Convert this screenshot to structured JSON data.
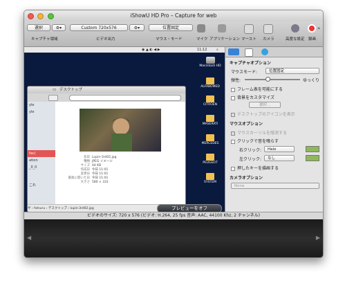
{
  "window": {
    "title": "iShowU HD Pro – Capture for web"
  },
  "toolbar": {
    "select_button": "選択",
    "capture_area_label": "キャプチャ領域",
    "preset_value": "Custom 720x576",
    "video_output_label": "ビデオ出力",
    "mouse_mode_value": "位置固定",
    "mouse_mode_label": "マウス・モード",
    "mic_label": "マイク",
    "app_label": "アプリケーション",
    "mouse_label": "マースト",
    "camera_label": "カメラ",
    "prefs_label": "高度な設定",
    "record_label": "録画"
  },
  "capture": {
    "menubar_clock": "11:12",
    "finder": {
      "title": "デスクトップ",
      "sidebar": [
        "yle",
        "yle",
        "fac)",
        "ation",
        "_0_0",
        "これ"
      ],
      "info_rows": [
        {
          "k": "名前",
          "v": "Lupin-3rd02.jpg"
        },
        {
          "k": "種類",
          "v": "JPEG イメージ"
        },
        {
          "k": "サイズ",
          "v": "44 KB"
        },
        {
          "k": "作成日",
          "v": "今日 11:01"
        },
        {
          "k": "変更日",
          "v": "今日 11:01"
        },
        {
          "k": "最後に開いた日",
          "v": "今日 11:01"
        },
        {
          "k": "大きさ",
          "v": "580 × 331"
        }
      ],
      "path": "ザ › fatsuru › デスクトップ › lupin-3rd02.jpg"
    },
    "dock_items": [
      "Macintosh HD",
      "ALFABOMED",
      "CITROEN",
      "MASERATI",
      "MERCEDES",
      "PEUGEOT",
      "SYSTEM"
    ],
    "preview_off_button": "プレビューをオフ"
  },
  "panel": {
    "capture_options_title": "キャプチャオプション",
    "mouse_mode_label": "マウスモード:",
    "mouse_mode_value": "位置固定",
    "elasticity_label": "弾性:",
    "elasticity_right": "ゆっくり",
    "frame_visible": "フレーム表を可能にする",
    "bg_customize": "背景をカスタマイズ",
    "select_button": "選択...",
    "show_desktop_icons": "デスクトップのアイコンを表示",
    "mouse_options_title": "マウスオプション",
    "hide_cursor": "マウスカーソルを隠消する",
    "click_sound": "クリックで音を鳴らす",
    "right_click_label": "右クリック:",
    "right_click_value": "Halo",
    "left_click_label": "左クリック:",
    "left_click_value": "なし",
    "show_pressed_keys": "押したキーを描画する",
    "camera_options_title": "カメラオプション",
    "camera_value": "None",
    "swatch_color": "#8fb85b"
  },
  "status": {
    "text": "ビデオのサイズ: 720 x 576 (ビデオ: H.264, 25 fps 音声: AAC, 44100 Khz, 2 チャンネル)"
  }
}
